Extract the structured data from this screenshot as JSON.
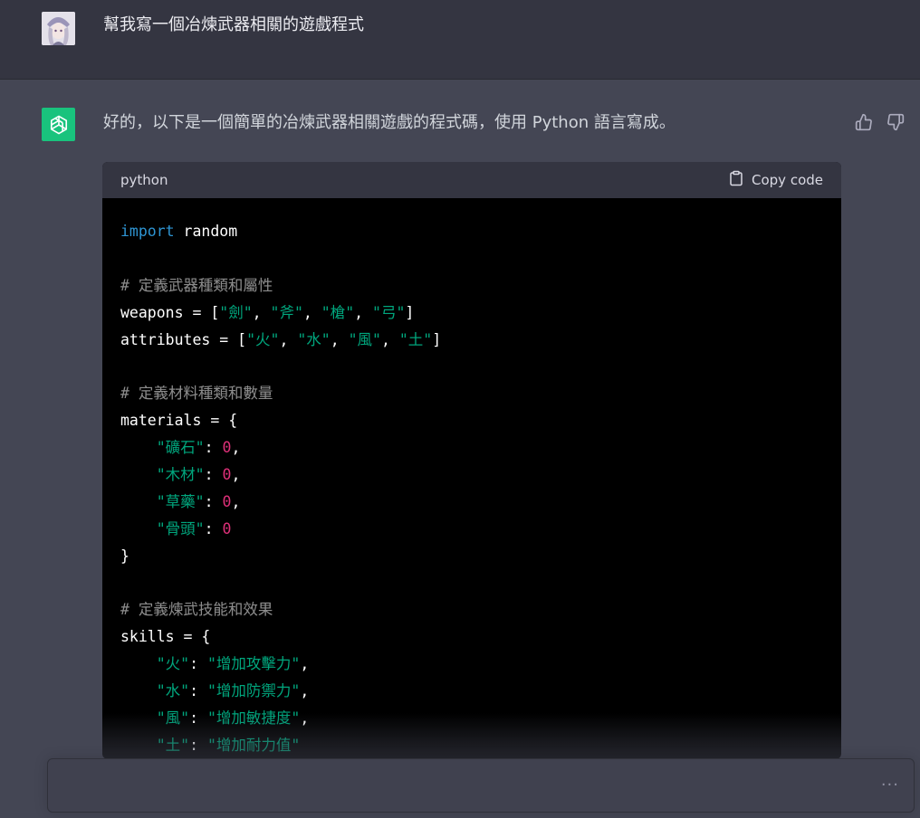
{
  "user_message": {
    "text": "幫我寫一個冶煉武器相關的遊戲程式"
  },
  "assistant_message": {
    "text": "好的，以下是一個簡單的冶煉武器相關遊戲的程式碼，使用 Python 語言寫成。"
  },
  "code_block": {
    "language": "python",
    "copy_label": "Copy code",
    "lines": [
      [
        {
          "t": "kw",
          "v": "import"
        },
        {
          "t": "plain",
          "v": " random"
        }
      ],
      [],
      [
        {
          "t": "com",
          "v": "# 定義武器種類和屬性"
        }
      ],
      [
        {
          "t": "plain",
          "v": "weapons = ["
        },
        {
          "t": "str",
          "v": "\"劍\""
        },
        {
          "t": "plain",
          "v": ", "
        },
        {
          "t": "str",
          "v": "\"斧\""
        },
        {
          "t": "plain",
          "v": ", "
        },
        {
          "t": "str",
          "v": "\"槍\""
        },
        {
          "t": "plain",
          "v": ", "
        },
        {
          "t": "str",
          "v": "\"弓\""
        },
        {
          "t": "plain",
          "v": "]"
        }
      ],
      [
        {
          "t": "plain",
          "v": "attributes = ["
        },
        {
          "t": "str",
          "v": "\"火\""
        },
        {
          "t": "plain",
          "v": ", "
        },
        {
          "t": "str",
          "v": "\"水\""
        },
        {
          "t": "plain",
          "v": ", "
        },
        {
          "t": "str",
          "v": "\"風\""
        },
        {
          "t": "plain",
          "v": ", "
        },
        {
          "t": "str",
          "v": "\"土\""
        },
        {
          "t": "plain",
          "v": "]"
        }
      ],
      [],
      [
        {
          "t": "com",
          "v": "# 定義材料種類和數量"
        }
      ],
      [
        {
          "t": "plain",
          "v": "materials = {"
        }
      ],
      [
        {
          "t": "plain",
          "v": "    "
        },
        {
          "t": "str",
          "v": "\"礦石\""
        },
        {
          "t": "plain",
          "v": ": "
        },
        {
          "t": "num",
          "v": "0"
        },
        {
          "t": "plain",
          "v": ","
        }
      ],
      [
        {
          "t": "plain",
          "v": "    "
        },
        {
          "t": "str",
          "v": "\"木材\""
        },
        {
          "t": "plain",
          "v": ": "
        },
        {
          "t": "num",
          "v": "0"
        },
        {
          "t": "plain",
          "v": ","
        }
      ],
      [
        {
          "t": "plain",
          "v": "    "
        },
        {
          "t": "str",
          "v": "\"草藥\""
        },
        {
          "t": "plain",
          "v": ": "
        },
        {
          "t": "num",
          "v": "0"
        },
        {
          "t": "plain",
          "v": ","
        }
      ],
      [
        {
          "t": "plain",
          "v": "    "
        },
        {
          "t": "str",
          "v": "\"骨頭\""
        },
        {
          "t": "plain",
          "v": ": "
        },
        {
          "t": "num",
          "v": "0"
        }
      ],
      [
        {
          "t": "plain",
          "v": "}"
        }
      ],
      [],
      [
        {
          "t": "com",
          "v": "# 定義煉武技能和效果"
        }
      ],
      [
        {
          "t": "plain",
          "v": "skills = {"
        }
      ],
      [
        {
          "t": "plain",
          "v": "    "
        },
        {
          "t": "str",
          "v": "\"火\""
        },
        {
          "t": "plain",
          "v": ": "
        },
        {
          "t": "str",
          "v": "\"增加攻擊力\""
        },
        {
          "t": "plain",
          "v": ","
        }
      ],
      [
        {
          "t": "plain",
          "v": "    "
        },
        {
          "t": "str",
          "v": "\"水\""
        },
        {
          "t": "plain",
          "v": ": "
        },
        {
          "t": "str",
          "v": "\"增加防禦力\""
        },
        {
          "t": "plain",
          "v": ","
        }
      ],
      [
        {
          "t": "plain",
          "v": "    "
        },
        {
          "t": "str",
          "v": "\"風\""
        },
        {
          "t": "plain",
          "v": ": "
        },
        {
          "t": "str",
          "v": "\"增加敏捷度\""
        },
        {
          "t": "plain",
          "v": ","
        }
      ],
      [
        {
          "t": "plain",
          "v": "    "
        },
        {
          "t": "str",
          "v": "\"土\""
        },
        {
          "t": "plain",
          "v": ": "
        },
        {
          "t": "str",
          "v": "\"增加耐力值\""
        }
      ]
    ]
  },
  "input": {
    "more_label": "···"
  },
  "colors": {
    "keyword": "#2e95d3",
    "string": "#00a67d",
    "number": "#df3079",
    "accent": "#19c37d"
  },
  "icons": [
    "user-avatar",
    "openai-logo-icon",
    "thumbs-up-icon",
    "thumbs-down-icon",
    "clipboard-icon",
    "more-dots-icon"
  ]
}
